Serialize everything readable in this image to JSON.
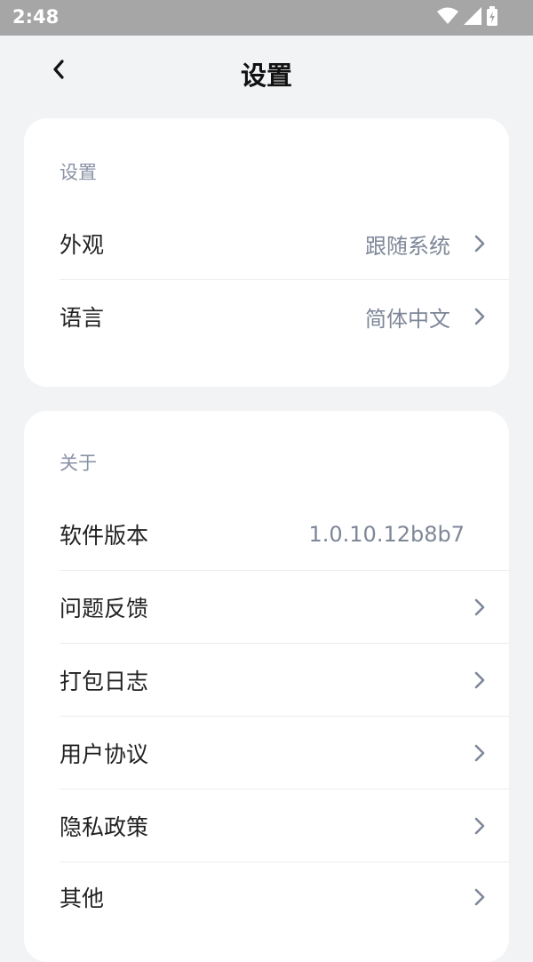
{
  "status_bar": {
    "time": "2:48"
  },
  "header": {
    "title": "设置"
  },
  "settings_section": {
    "title": "设置",
    "items": [
      {
        "label": "外观",
        "value": "跟随系统"
      },
      {
        "label": "语言",
        "value": "简体中文"
      }
    ]
  },
  "about_section": {
    "title": "关于",
    "items": [
      {
        "label": "软件版本",
        "value": "1.0.10.12b8b7"
      },
      {
        "label": "问题反馈"
      },
      {
        "label": "打包日志"
      },
      {
        "label": "用户协议"
      },
      {
        "label": "隐私政策"
      },
      {
        "label": "其他"
      }
    ]
  },
  "colors": {
    "background": "#f2f3f5",
    "card": "#ffffff",
    "muted_text": "#8a93a6",
    "status_bar": "#a6a6a6"
  },
  "icons": [
    "back-arrow-icon",
    "chevron-right-icon",
    "wifi-icon",
    "signal-icon",
    "battery-icon"
  ]
}
